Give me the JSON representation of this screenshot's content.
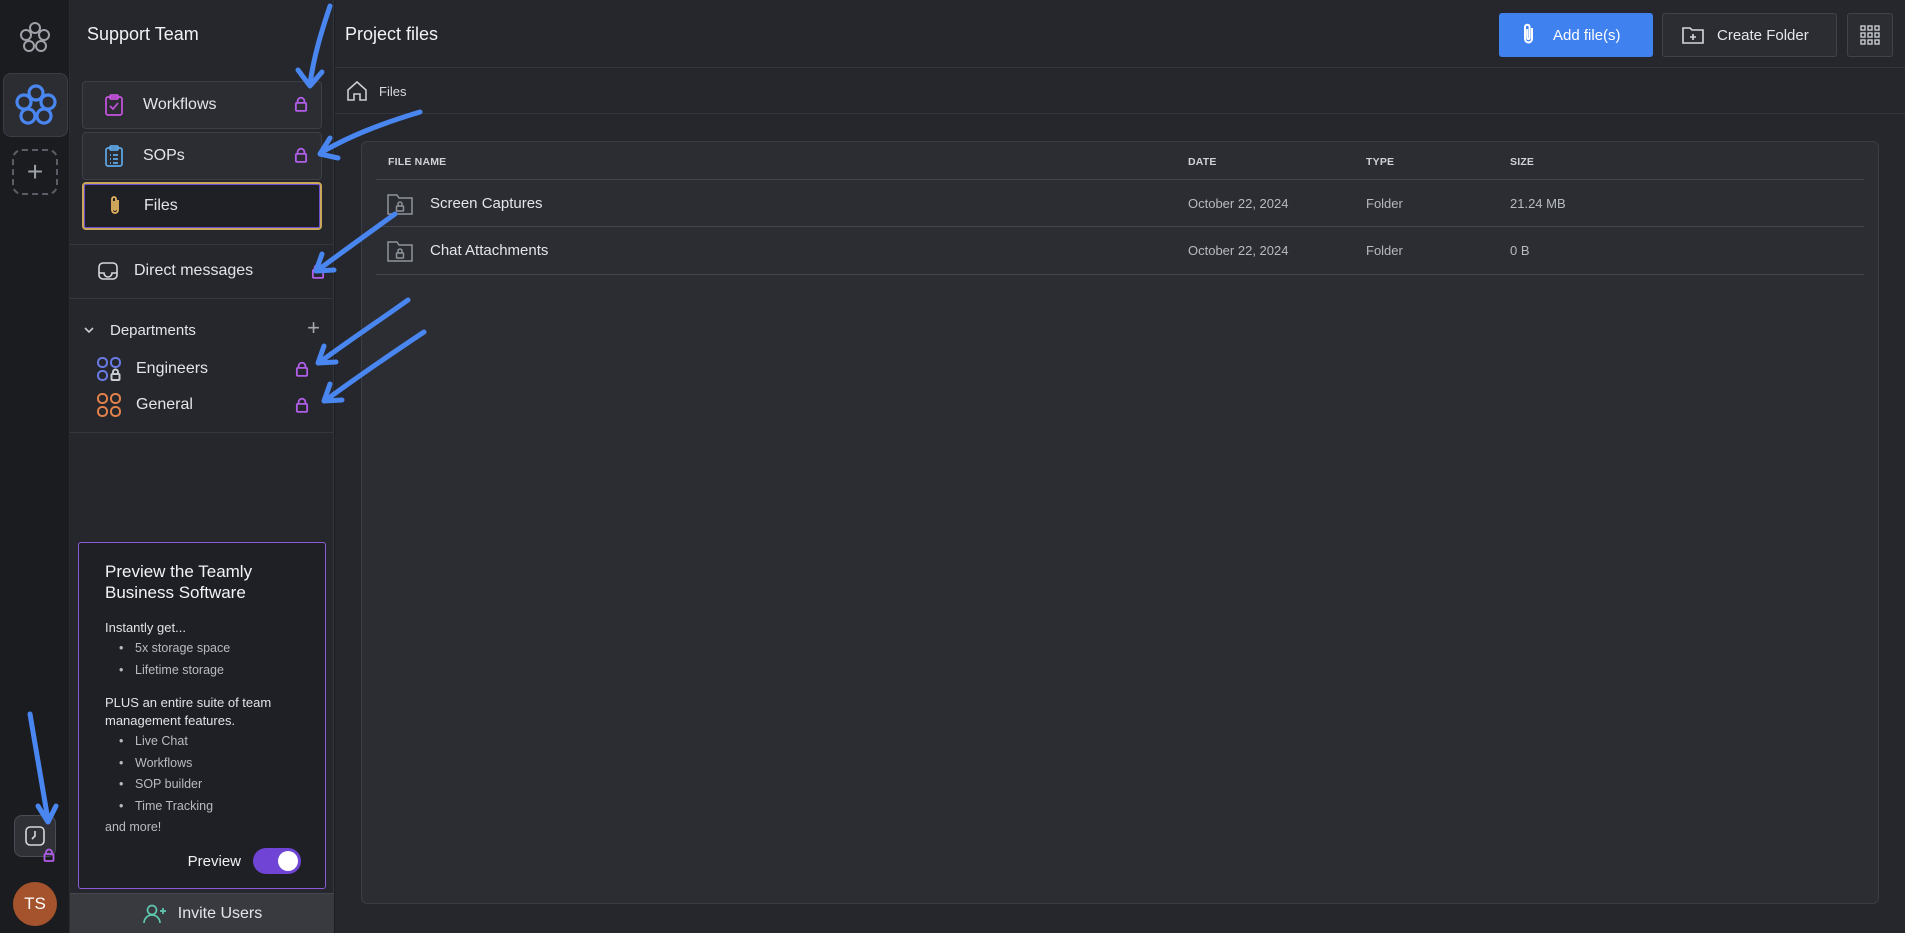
{
  "rail": {
    "avatar_initials": "TS"
  },
  "sidebar": {
    "team_name": "Support Team",
    "items": [
      {
        "label": "Workflows",
        "icon": "clipboard-check-icon",
        "locked": true
      },
      {
        "label": "SOPs",
        "icon": "clipboard-list-icon",
        "locked": true
      },
      {
        "label": "Files",
        "icon": "paperclip-icon",
        "locked": false,
        "active": true
      }
    ],
    "direct_messages": {
      "label": "Direct messages",
      "locked": true
    },
    "departments": {
      "label": "Departments",
      "items": [
        {
          "label": "Engineers",
          "locked": true
        },
        {
          "label": "General",
          "locked": true
        }
      ]
    },
    "promo": {
      "title": "Preview the Teamly Business Software",
      "intro": "Instantly get...",
      "benefits": [
        "5x storage space",
        "Lifetime storage"
      ],
      "plus_text": "PLUS an entire suite of team management features.",
      "features": [
        "Live Chat",
        "Workflows",
        "SOP builder",
        "Time Tracking"
      ],
      "more": "and more!",
      "preview_label": "Preview",
      "preview_on": true
    },
    "invite_label": "Invite Users"
  },
  "main": {
    "title": "Project files",
    "add_files_label": "Add file(s)",
    "create_folder_label": "Create Folder",
    "breadcrumb": "Files",
    "table": {
      "headers": [
        "FILE NAME",
        "DATE",
        "TYPE",
        "SIZE"
      ],
      "rows": [
        {
          "name": "Screen Captures",
          "date": "October 22, 2024",
          "type": "Folder",
          "size": "21.24 MB"
        },
        {
          "name": "Chat Attachments",
          "date": "October 22, 2024",
          "type": "Folder",
          "size": "0 B"
        }
      ]
    }
  },
  "colors": {
    "accent_blue": "#3f81ef",
    "lock_purple": "#b05ee8",
    "annotation_arrow": "#4a86f0",
    "toggle_purple": "#7044d4",
    "avatar": "#a4532c"
  }
}
